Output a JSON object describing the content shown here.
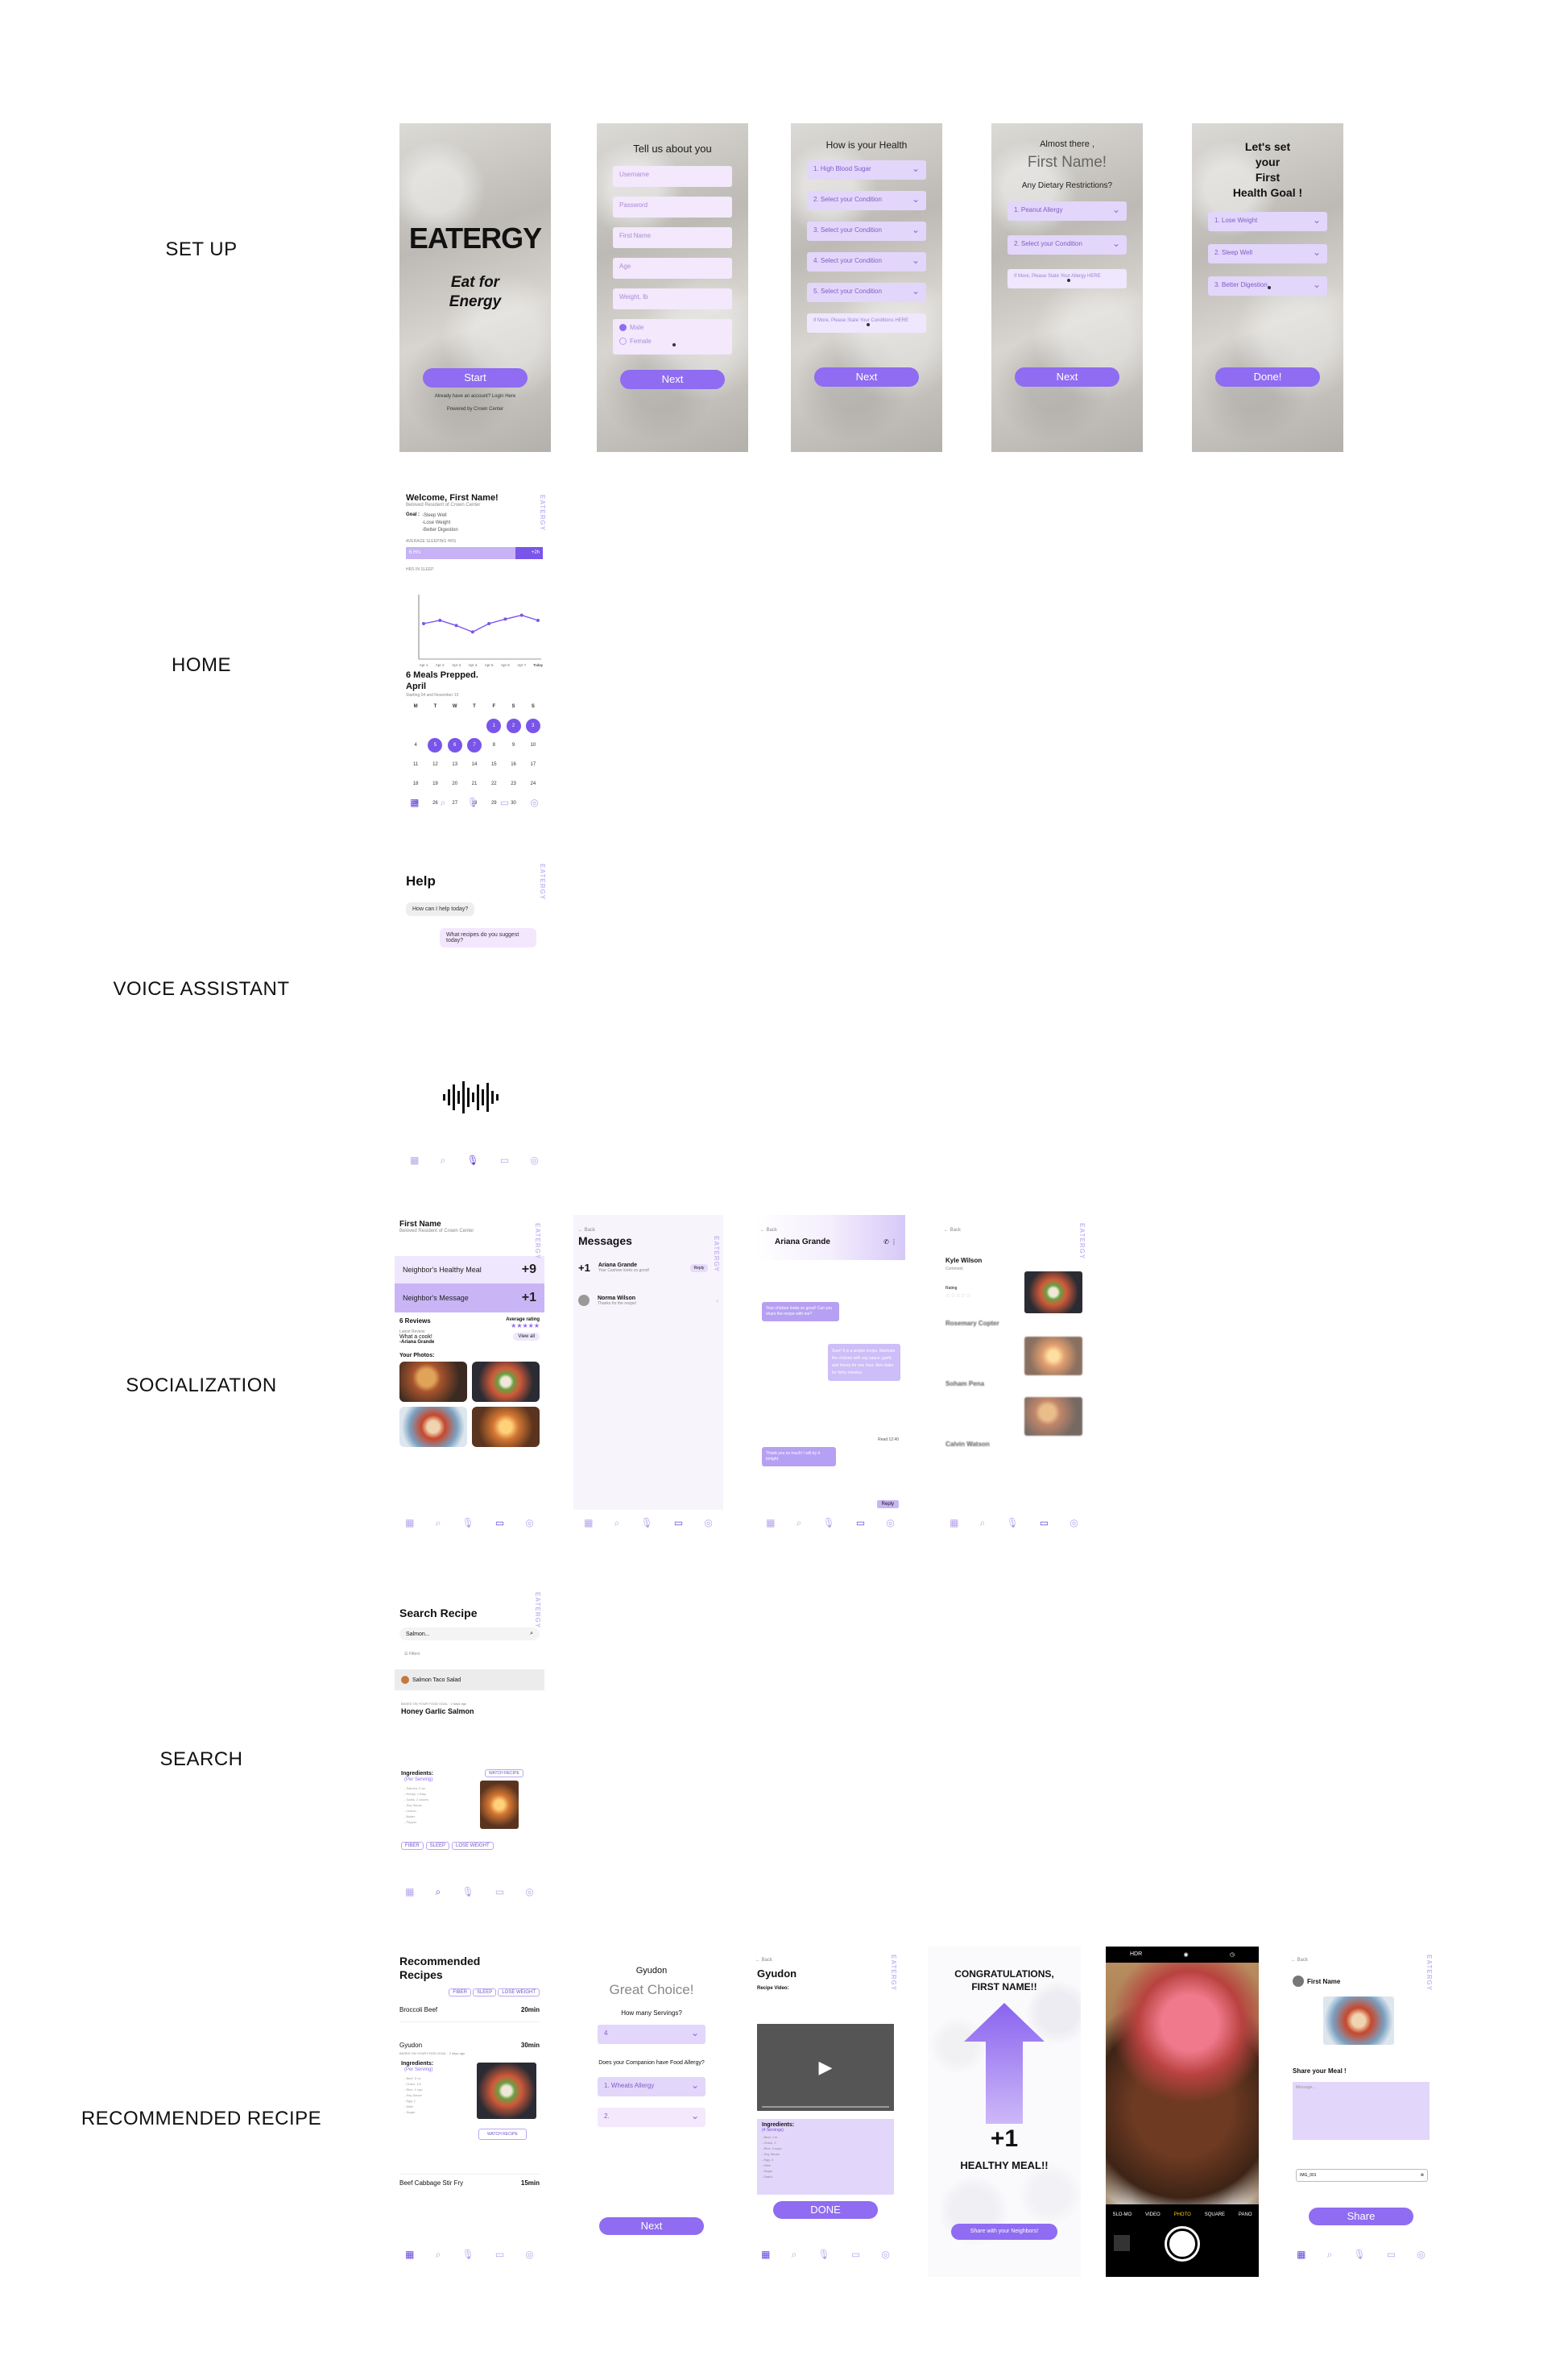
{
  "sections": {
    "setup": "SET UP",
    "home": "HOME",
    "voice": "VOICE ASSISTANT",
    "social": "SOCIALIZATION",
    "search": "SEARCH",
    "recommended": "RECOMMENDED RECIPE"
  },
  "brand": {
    "logo": "EATERGY",
    "tagline_1": "Eat for",
    "tagline_2": "Energy",
    "vertical": "EATERGY",
    "accent": "#8f6cf1"
  },
  "splash": {
    "start": "Start",
    "account": "Already have an account? Login Here",
    "powered": "Powered by Crown Center"
  },
  "about": {
    "title": "Tell us about you",
    "fields": [
      "Username",
      "Password",
      "First Name",
      "Age",
      "Weight, lb"
    ],
    "male": "Male",
    "female": "Female",
    "next": "Next"
  },
  "health": {
    "title": "How is your Health",
    "items": [
      "1. High Blood Sugar",
      "2. Select your Condition",
      "3. Select your Condition",
      "4. Select your Condition",
      "5. Select your Condition"
    ],
    "more": "If More, Please State Your Conditions HERE",
    "next": "Next"
  },
  "diet": {
    "almost": "Almost there ,",
    "name": "First Name!",
    "question": "Any Dietary Restrictions?",
    "items": [
      "1. Peanut Allergy",
      "2. Select your Condition"
    ],
    "more": "If More, Please State Your Allergy HERE",
    "next": "Next"
  },
  "goal": {
    "l1": "Let's set",
    "l2": "your",
    "l3": "First",
    "l4": "Health Goal !",
    "items": [
      "1. Lose Weight",
      "2. Sleep Well",
      "3. Better Digestion"
    ],
    "done": "Done!"
  },
  "home": {
    "welcome": "Welcome, First Name!",
    "sub": "Beloved Resident of Crown Center",
    "goal_label": "Goal :",
    "goals": [
      "-Sleep Well",
      "-Lose Weight",
      "-Better Digestion"
    ],
    "sleep_label": "AVERAGE SLEEPING HRS",
    "bar_left": "6 Hrs",
    "bar_right": "+2h",
    "chart_label": "HRS IN SLEEP",
    "meals": "6 Meals Prepped.",
    "month": "April",
    "week": "Starting 04 and November 13",
    "weekdays": [
      "M",
      "T",
      "W",
      "T",
      "F",
      "S",
      "S"
    ]
  },
  "chart_data": {
    "type": "line",
    "categories": [
      "Apr 1",
      "Apr 2",
      "Apr 3",
      "Apr 4",
      "Apr 5",
      "Apr 6",
      "Apr 7",
      "Today"
    ],
    "values": [
      5.5,
      6.0,
      5.2,
      4.2,
      5.5,
      6.2,
      6.8,
      6.0
    ],
    "ylim": [
      0,
      10
    ],
    "grid": false,
    "title": "",
    "xlabel": "",
    "ylabel": ""
  },
  "calendar": {
    "rows": [
      [
        "",
        "",
        "",
        "",
        "1",
        "2",
        "3"
      ],
      [
        "4",
        "5",
        "6",
        "7",
        "8",
        "9",
        "10"
      ],
      [
        "11",
        "12",
        "13",
        "14",
        "15",
        "16",
        "17"
      ],
      [
        "18",
        "19",
        "20",
        "21",
        "22",
        "23",
        "24"
      ],
      [
        "25",
        "26",
        "27",
        "28",
        "29",
        "30",
        ""
      ]
    ],
    "highlighted": [
      "1",
      "2",
      "3",
      "5",
      "6",
      "7"
    ]
  },
  "voice": {
    "title": "Help",
    "q": "How can I help today?",
    "a": "What recipes do you suggest today?"
  },
  "social": {
    "name": "First Name",
    "sub": "Beloved Resident of Crown Center",
    "row1": "Neighbor's Healthy Meal",
    "row1_count": "+9",
    "row2": "Neighbor's Message",
    "row2_count": "+1",
    "reviews": "6 Reviews",
    "avg": "Average rating",
    "latest": "Latest Review",
    "quote": "What a cook!",
    "author": "-Ariana Grande",
    "view": "View all",
    "photos": "Your Photos:"
  },
  "messages": {
    "back": "Back",
    "title": "Messages",
    "items": [
      {
        "count": "+1",
        "name": "Ariana Grande",
        "preview": "Your Cashew looks so good!",
        "reply": "Reply"
      },
      {
        "count": "",
        "name": "Norma Wilson",
        "preview": "Thanks for the recipe!"
      }
    ]
  },
  "chat": {
    "back": "Back",
    "name": "Ariana Grande",
    "m1": "Your chicken looks so good! Can you share the recipe with me?",
    "m2": "Sure! It is a simple recipe. Marinate the chicken with soy sauce, garlic and honey for one hour, then bake for thirty minutes.",
    "read": "Read 12:40",
    "m3": "Thank you so much! I will try it tonight.",
    "reply": "Reply"
  },
  "reviews": {
    "back": "Back",
    "people": [
      "Kyle Wilson",
      "Rosemary Copter",
      "Soham Pena",
      "Calvin Watson"
    ],
    "label": "Comment",
    "rating": "Rating"
  },
  "search": {
    "title": "Search Recipe",
    "query": "Salmon...",
    "filters": "Filters",
    "r1": "Salmon Taco Salad",
    "r2_meta": "BASED ON YOUR FOOD GOAL · 2 days ago",
    "r2": "Honey Garlic Salmon",
    "ingredients": "Ingredients:",
    "per": "(Per Serving)",
    "items": [
      "- Salmon, 5 oz",
      "- Honey, 1 tbsp",
      "- Garlic, 2 cloves",
      "- Soy Sauce",
      "- Lemon",
      "- Butter",
      "- Pepper"
    ],
    "watch": "WATCH RECIPE",
    "tags": [
      "FIBER",
      "SLEEP",
      "LOSE WEIGHT"
    ]
  },
  "rec": {
    "title_1": "Recommended",
    "title_2": "Recipes",
    "tags": [
      "FIBER",
      "SLEEP",
      "LOSE WEIGHT"
    ],
    "list": [
      {
        "name": "Broccoli Beef",
        "time": "20min"
      },
      {
        "name": "Gyudon",
        "time": "30min"
      },
      {
        "name": "Beef Cabbage Stir Fry",
        "time": "15min"
      }
    ],
    "meta": "BASED ON YOUR FOOD GOAL · 2 days ago",
    "ingredients": "Ingredients:",
    "per": "(Per Serving)",
    "items": [
      "- Beef, 5 oz",
      "- Onion, 1/2",
      "- Rice, 1 cup",
      "- Soy Sauce",
      "- Egg, 1",
      "- Mirin",
      "- Sugar"
    ],
    "watch": "WATCH RECIPE"
  },
  "choice": {
    "dish": "Gyudon",
    "title": "Great Choice!",
    "servings": "How many Servings?",
    "servings_val": "4",
    "allergy": "Does your Companion have Food Allergy?",
    "a1": "1. Wheats Allergy",
    "a2": "2.",
    "next": "Next"
  },
  "video": {
    "back": "Back",
    "title": "Gyudon",
    "label": "Recipe Video:",
    "ingredients": "Ingredients:",
    "per": "(4 Servings)",
    "items": [
      "- Beef, 1 lb",
      "- Onion, 2",
      "- Rice, 4 cups",
      "- Soy Sauce",
      "- Egg, 4",
      "- Mirin",
      "- Sugar",
      "- Dashi"
    ],
    "done": "DONE"
  },
  "congrats": {
    "l1": "CONGRATULATIONS,",
    "l2": "FIRST NAME!!",
    "plus": "+1",
    "healthy": "HEALTHY MEAL!!",
    "share": "Share with your Neighbors!"
  },
  "camera": {
    "hdr": "HDR",
    "modes": [
      "SLO-MO",
      "VIDEO",
      "PHOTO",
      "SQUARE",
      "PANO"
    ]
  },
  "share": {
    "back": "Back",
    "name": "First Name",
    "label": "Share your Meal !",
    "message_ph": "Message...",
    "file": "IMG_001",
    "button": "Share"
  },
  "nav": {
    "icons": [
      "home-icon",
      "search-icon",
      "mic-icon",
      "chat-icon",
      "profile-icon"
    ]
  }
}
